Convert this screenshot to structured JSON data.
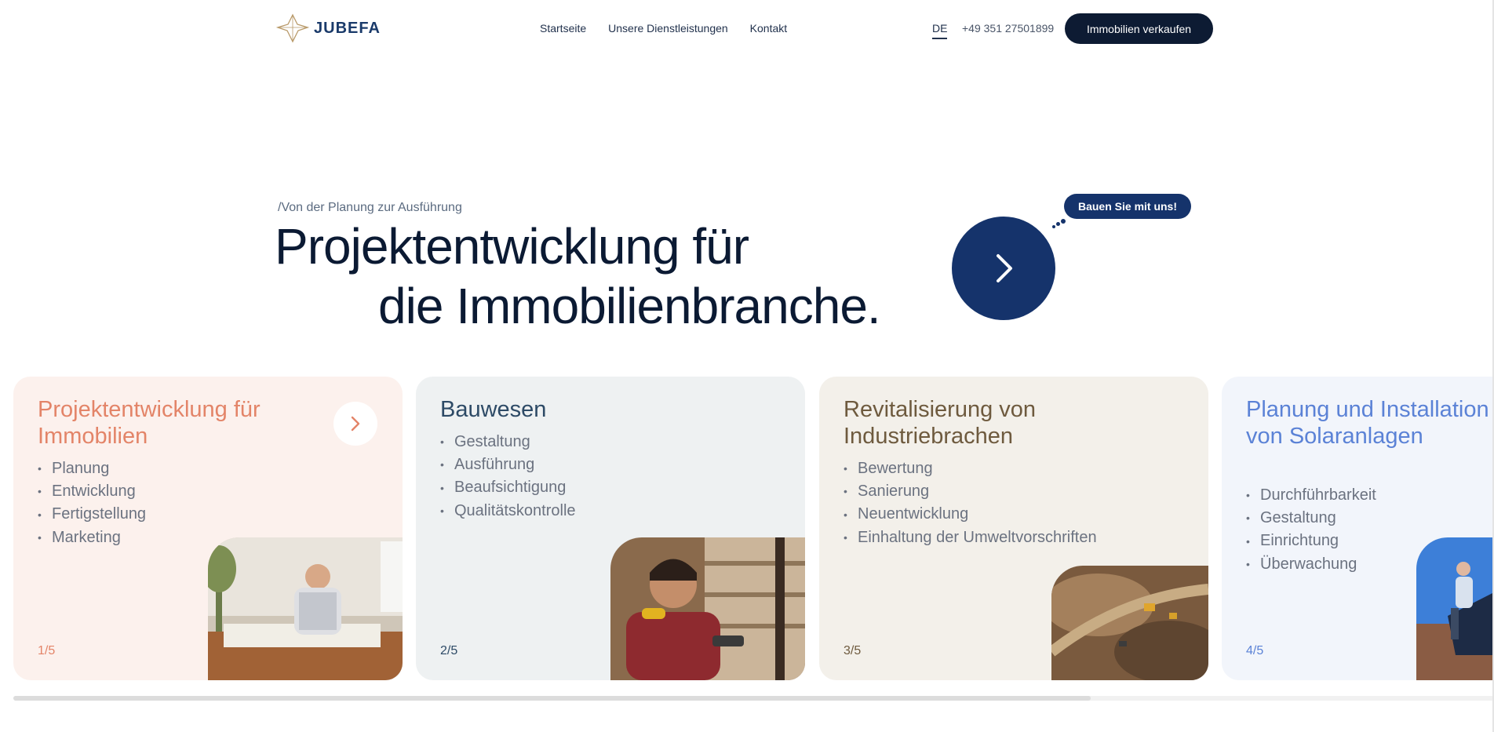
{
  "header": {
    "logo_text": "JUBEFA",
    "nav": [
      "Startseite",
      "Unsere Dienstleistungen",
      "Kontakt"
    ],
    "lang": "DE",
    "phone": "+49 351 27501899",
    "cta": "Immobilien verkaufen"
  },
  "hero": {
    "eyebrow": "/Von der Planung zur Ausführung",
    "headline_line1": "Projektentwicklung für",
    "headline_line2": "die Immobilienbranche.",
    "bubble": "Bauen Sie mit uns!",
    "accent_color": "#15336b"
  },
  "cards": [
    {
      "title": "Projektentwicklung für Immobilien",
      "items": [
        "Planung",
        "Entwicklung",
        "Fertigstellung",
        "Marketing"
      ],
      "counter": "1/5",
      "bg": "#fcf1ed",
      "color": "#e38468"
    },
    {
      "title": "Bauwesen",
      "items": [
        "Gestaltung",
        "Ausführung",
        "Beaufsichtigung",
        "Qualitätskontrolle"
      ],
      "counter": "2/5",
      "bg": "#eef1f2",
      "color": "#2d4a66"
    },
    {
      "title": "Revitalisierung von Industriebrachen",
      "items": [
        "Bewertung",
        "Sanierung",
        "Neuentwicklung",
        "Einhaltung der Umweltvorschriften"
      ],
      "counter": "3/5",
      "bg": "#f3f0ea",
      "color": "#6e5a3e"
    },
    {
      "title": "Planung und Installation von Solaranlagen",
      "items": [
        "Durchführbarkeit",
        "Gestaltung",
        "Einrichtung",
        "Überwachung"
      ],
      "counter": "4/5",
      "bg": "#f2f5fb",
      "color": "#5b82d6"
    }
  ]
}
